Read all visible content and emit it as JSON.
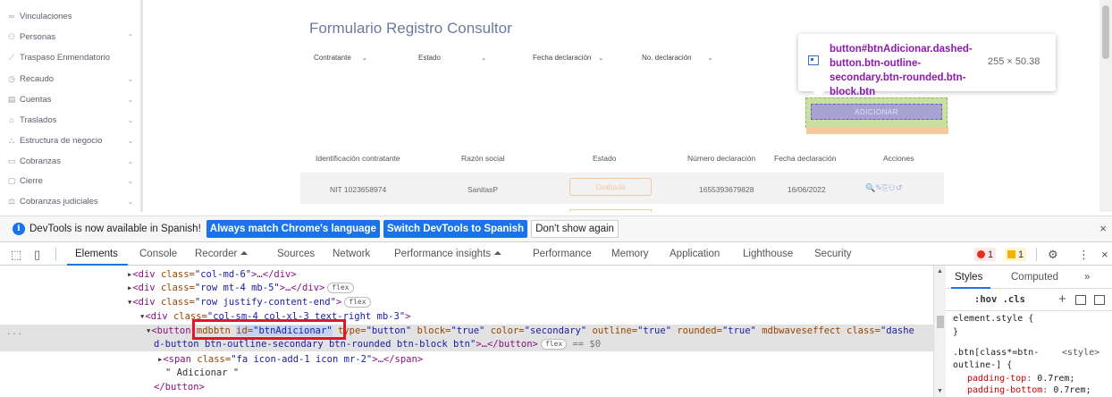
{
  "sidebar": {
    "items": [
      {
        "icon": "∞",
        "label": "Vinculaciones",
        "chevron": ""
      },
      {
        "icon": "⚇",
        "label": "Personas",
        "chevron": "⌃"
      },
      {
        "icon": "⟋",
        "label": "Traspaso Enmendatorio",
        "chevron": ""
      },
      {
        "icon": "◷",
        "label": "Recaudo",
        "chevron": "⌄"
      },
      {
        "icon": "▤",
        "label": "Cuentas",
        "chevron": "⌄"
      },
      {
        "icon": "⌂",
        "label": "Traslados",
        "chevron": "⌄"
      },
      {
        "icon": "⛬",
        "label": "Estructura de negocio",
        "chevron": "⌄"
      },
      {
        "icon": "▭",
        "label": "Cobranzas",
        "chevron": "⌄"
      },
      {
        "icon": "▢",
        "label": "Cierre",
        "chevron": "⌄"
      },
      {
        "icon": "⚖",
        "label": "Cobranzas judiciales",
        "chevron": "⌄"
      }
    ]
  },
  "page": {
    "title": "Formulario Registro Consultor",
    "filters": [
      {
        "label": "Contratante"
      },
      {
        "label": "Estado"
      },
      {
        "label": "Fecha declaración"
      },
      {
        "label": "No. declaración"
      }
    ],
    "adicionar_label": "ADICIONAR",
    "table": {
      "headers": [
        "Identificación contratante",
        "Razón social",
        "Estado",
        "Número declaración",
        "Fecha declaración",
        "Acciones"
      ],
      "row": {
        "identificacion": "NIT 1023658974",
        "razon_social": "SanitasP",
        "estado": "Grabada",
        "numero": "1655393679828",
        "fecha": "16/06/2022",
        "acciones": "🔍✎⎘⚇↺"
      }
    },
    "chevron": "⌄"
  },
  "tooltip": {
    "element_name": "button#btnAdicionar.dashed-button.btn-outline-secondary.btn-rounded.btn-block.btn",
    "size": "255 × 50.38"
  },
  "infobar": {
    "message": "DevTools is now available in Spanish!",
    "btn_match": "Always match Chrome's language",
    "btn_switch": "Switch DevTools to Spanish",
    "btn_dismiss": "Don't show again",
    "close": "×"
  },
  "devtools": {
    "tabs": [
      "Elements",
      "Console",
      "Recorder ⏶",
      "Sources",
      "Network",
      "Performance insights ⏶",
      "Performance",
      "Memory",
      "Application",
      "Lighthouse",
      "Security"
    ],
    "error_count": "1",
    "warning_count": "1",
    "settings_icon": "⚙",
    "more_icon": "⋮",
    "close_icon": "×"
  },
  "elements": {
    "lines": {
      "l1_tag": "<div",
      "l1_attr": " class=",
      "l1_val": "\"col-md-6\"",
      "l1_rest": ">…</div>",
      "l2_tag": "<div",
      "l2_attr": " class=",
      "l2_val": "\"row mt-4 mb-5\"",
      "l2_rest": ">…</div>",
      "l2_pill": "flex",
      "l3_tag": "<div",
      "l3_attr": " class=",
      "l3_val": "\"row justify-content-end\"",
      "l3_rest": ">",
      "l3_pill": "flex",
      "l4_tag": "<div",
      "l4_attr": " class=",
      "l4_val": "\"col-sm-4 col-xl-3 text-right mb-3\"",
      "l4_rest": ">",
      "l5_tag": "<button",
      "l5_a1": " mdbbtn ",
      "l5_a2": "id=",
      "l5_v2": "\"btnAdicionar\"",
      "l5_a3": " type=",
      "l5_v3": "\"button\"",
      "l5_a4": " block=",
      "l5_v4": "\"true\"",
      "l5_a5": " color=",
      "l5_v5": "\"secondary\"",
      "l5_a6": " outline=",
      "l5_v6": "\"true\"",
      "l5_a7": " rounded=",
      "l5_v7": "\"true\"",
      "l5_a8": " mdbwaveseffect class=",
      "l5_v8": "\"dashe",
      "l6_v": "d-button btn-outline-secondary btn-rounded btn-block btn\"",
      "l6_rest": ">…</button>",
      "l6_pill": "flex",
      "l6_eq": " == $0",
      "l7_tag": "<span",
      "l7_attr": " class=",
      "l7_val": "\"fa icon-add-1 icon mr-2\"",
      "l7_rest": ">…</span>",
      "l8_text": "\" Adicionar \"",
      "l9_tag": "</button>"
    },
    "ellipsis": "..."
  },
  "styles": {
    "tab_styles": "Styles",
    "tab_computed": "Computed",
    "tab_more": "»",
    "filter": ":hov  .cls",
    "plus": "+",
    "element_style": "element.style {",
    "close_brace": "}",
    "rule_selector": ".btn[class*=btn-",
    "rule_selector2": "outline-] {",
    "rule_source": "<style>",
    "prop1": "padding-top",
    "val1": "0.7rem;",
    "prop2": "padding-bottom",
    "val2": "0.7rem;"
  }
}
